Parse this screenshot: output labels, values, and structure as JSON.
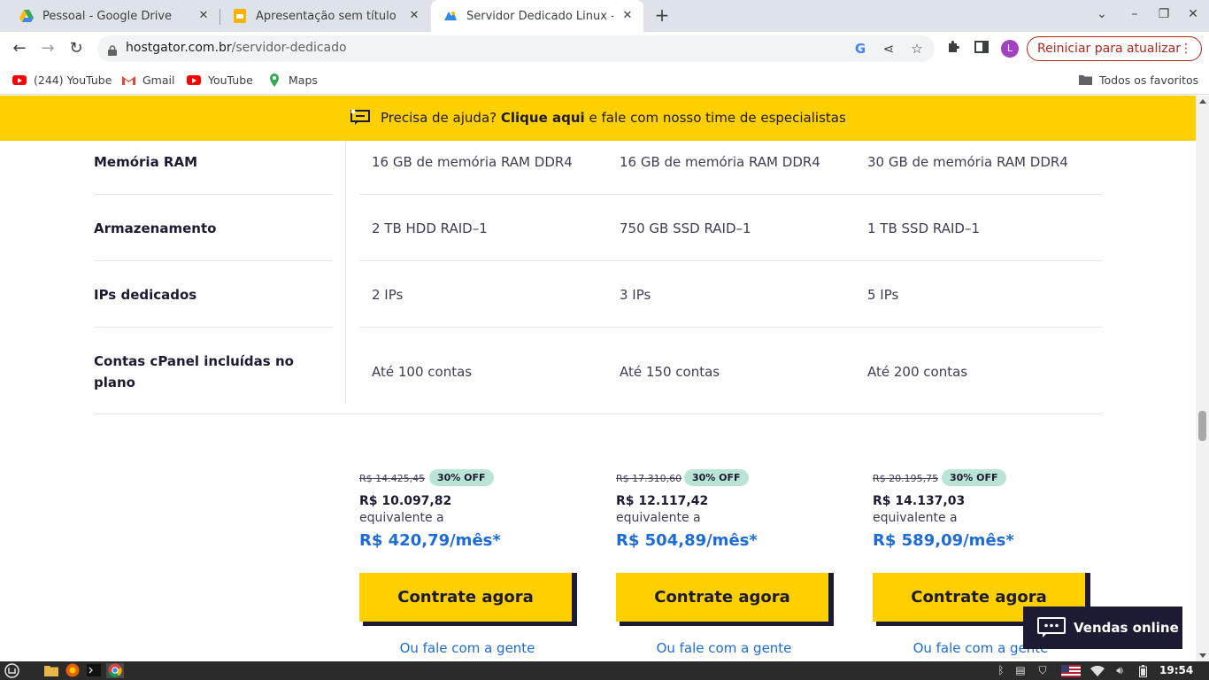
{
  "browser": {
    "tabs": [
      {
        "title": "Pessoal - Google Drive",
        "icon": "google-drive-icon",
        "active": false
      },
      {
        "title": "Apresentação sem título - Apresentações Google",
        "icon": "google-slides-icon",
        "active": false
      },
      {
        "title": "Servidor Dedicado Linux - A melhor",
        "icon": "hostgator-icon",
        "active": true
      }
    ],
    "new_tab_label": "+",
    "url_host": "hostgator.com.br",
    "url_path": "/servidor-dedicado",
    "profile_initial": "L",
    "update_button": "Reiniciar para atualizar",
    "bookmarks": [
      {
        "label": "(244) YouTube",
        "icon": "youtube-icon"
      },
      {
        "label": "Gmail",
        "icon": "gmail-icon"
      },
      {
        "label": "YouTube",
        "icon": "youtube-icon"
      },
      {
        "label": "Maps",
        "icon": "maps-icon"
      }
    ],
    "all_bookmarks": "Todos os favoritos"
  },
  "helpbar": {
    "prefix": "Precisa de ajuda?",
    "link": "Clique aqui",
    "suffix": "e fale com nosso time de especialistas"
  },
  "specs": {
    "rows": [
      {
        "label": "Memória RAM",
        "values": [
          "16 GB de memória RAM DDR4",
          "16 GB de memória RAM DDR4",
          "30 GB de memória RAM DDR4"
        ]
      },
      {
        "label": "Armazenamento",
        "values": [
          "2 TB HDD RAID–1",
          "750 GB SSD RAID–1",
          "1 TB SSD RAID–1"
        ]
      },
      {
        "label": "IPs dedicados",
        "values": [
          "2 IPs",
          "3 IPs",
          "5 IPs"
        ]
      },
      {
        "label_line1": "Contas cPanel incluídas no",
        "label_line2": "plano",
        "values": [
          "Até 100 contas",
          "Até 150 contas",
          "Até 200 contas"
        ]
      }
    ]
  },
  "plans": [
    {
      "old_price": "R$ 14.425,45",
      "discount": "30% OFF",
      "price": "R$ 10.097,82",
      "equivalent": "equivalente a",
      "monthly": "R$ 420,79/mês*",
      "cta": "Contrate agora",
      "talk": "Ou fale com a gente"
    },
    {
      "old_price": "R$ 17.310,60",
      "discount": "30% OFF",
      "price": "R$ 12.117,42",
      "equivalent": "equivalente a",
      "monthly": "R$ 504,89/mês*",
      "cta": "Contrate agora",
      "talk": "Ou fale com a gente"
    },
    {
      "old_price": "R$ 20.195,75",
      "discount": "30% OFF",
      "price": "R$ 14.137,03",
      "equivalent": "equivalente a",
      "monthly": "R$ 589,09/mês*",
      "cta": "Contrate agora",
      "talk": "Ou fale com a gente"
    }
  ],
  "chat_widget": {
    "label": "Vendas online"
  },
  "taskbar": {
    "clock": "19:54"
  },
  "colors": {
    "brand_yellow": "#ffd000",
    "brand_navy": "#1d1b33",
    "price_blue": "#1d6cd6",
    "badge_green": "#b9e4d6"
  }
}
